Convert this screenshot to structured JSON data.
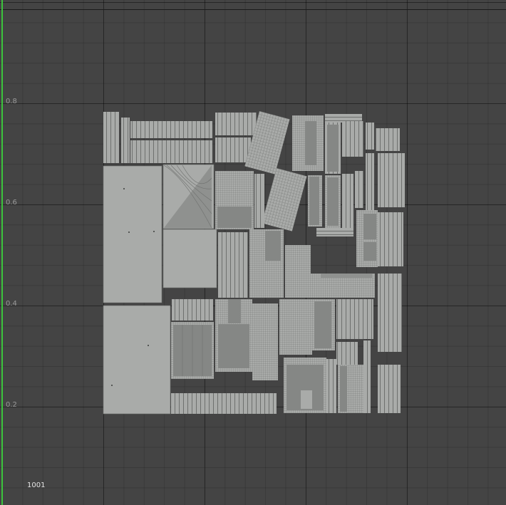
{
  "viewport": {
    "v_axis_labels": [
      "0.8",
      "0.6",
      "0.4",
      "0.2"
    ],
    "tile_label": "1001",
    "colors": {
      "background": "#444444",
      "grid_major": "#2b2b2b",
      "v_axis": "#3cc43c",
      "uv_shell": "#a9aba9",
      "uv_wire": "#6e706e"
    }
  }
}
